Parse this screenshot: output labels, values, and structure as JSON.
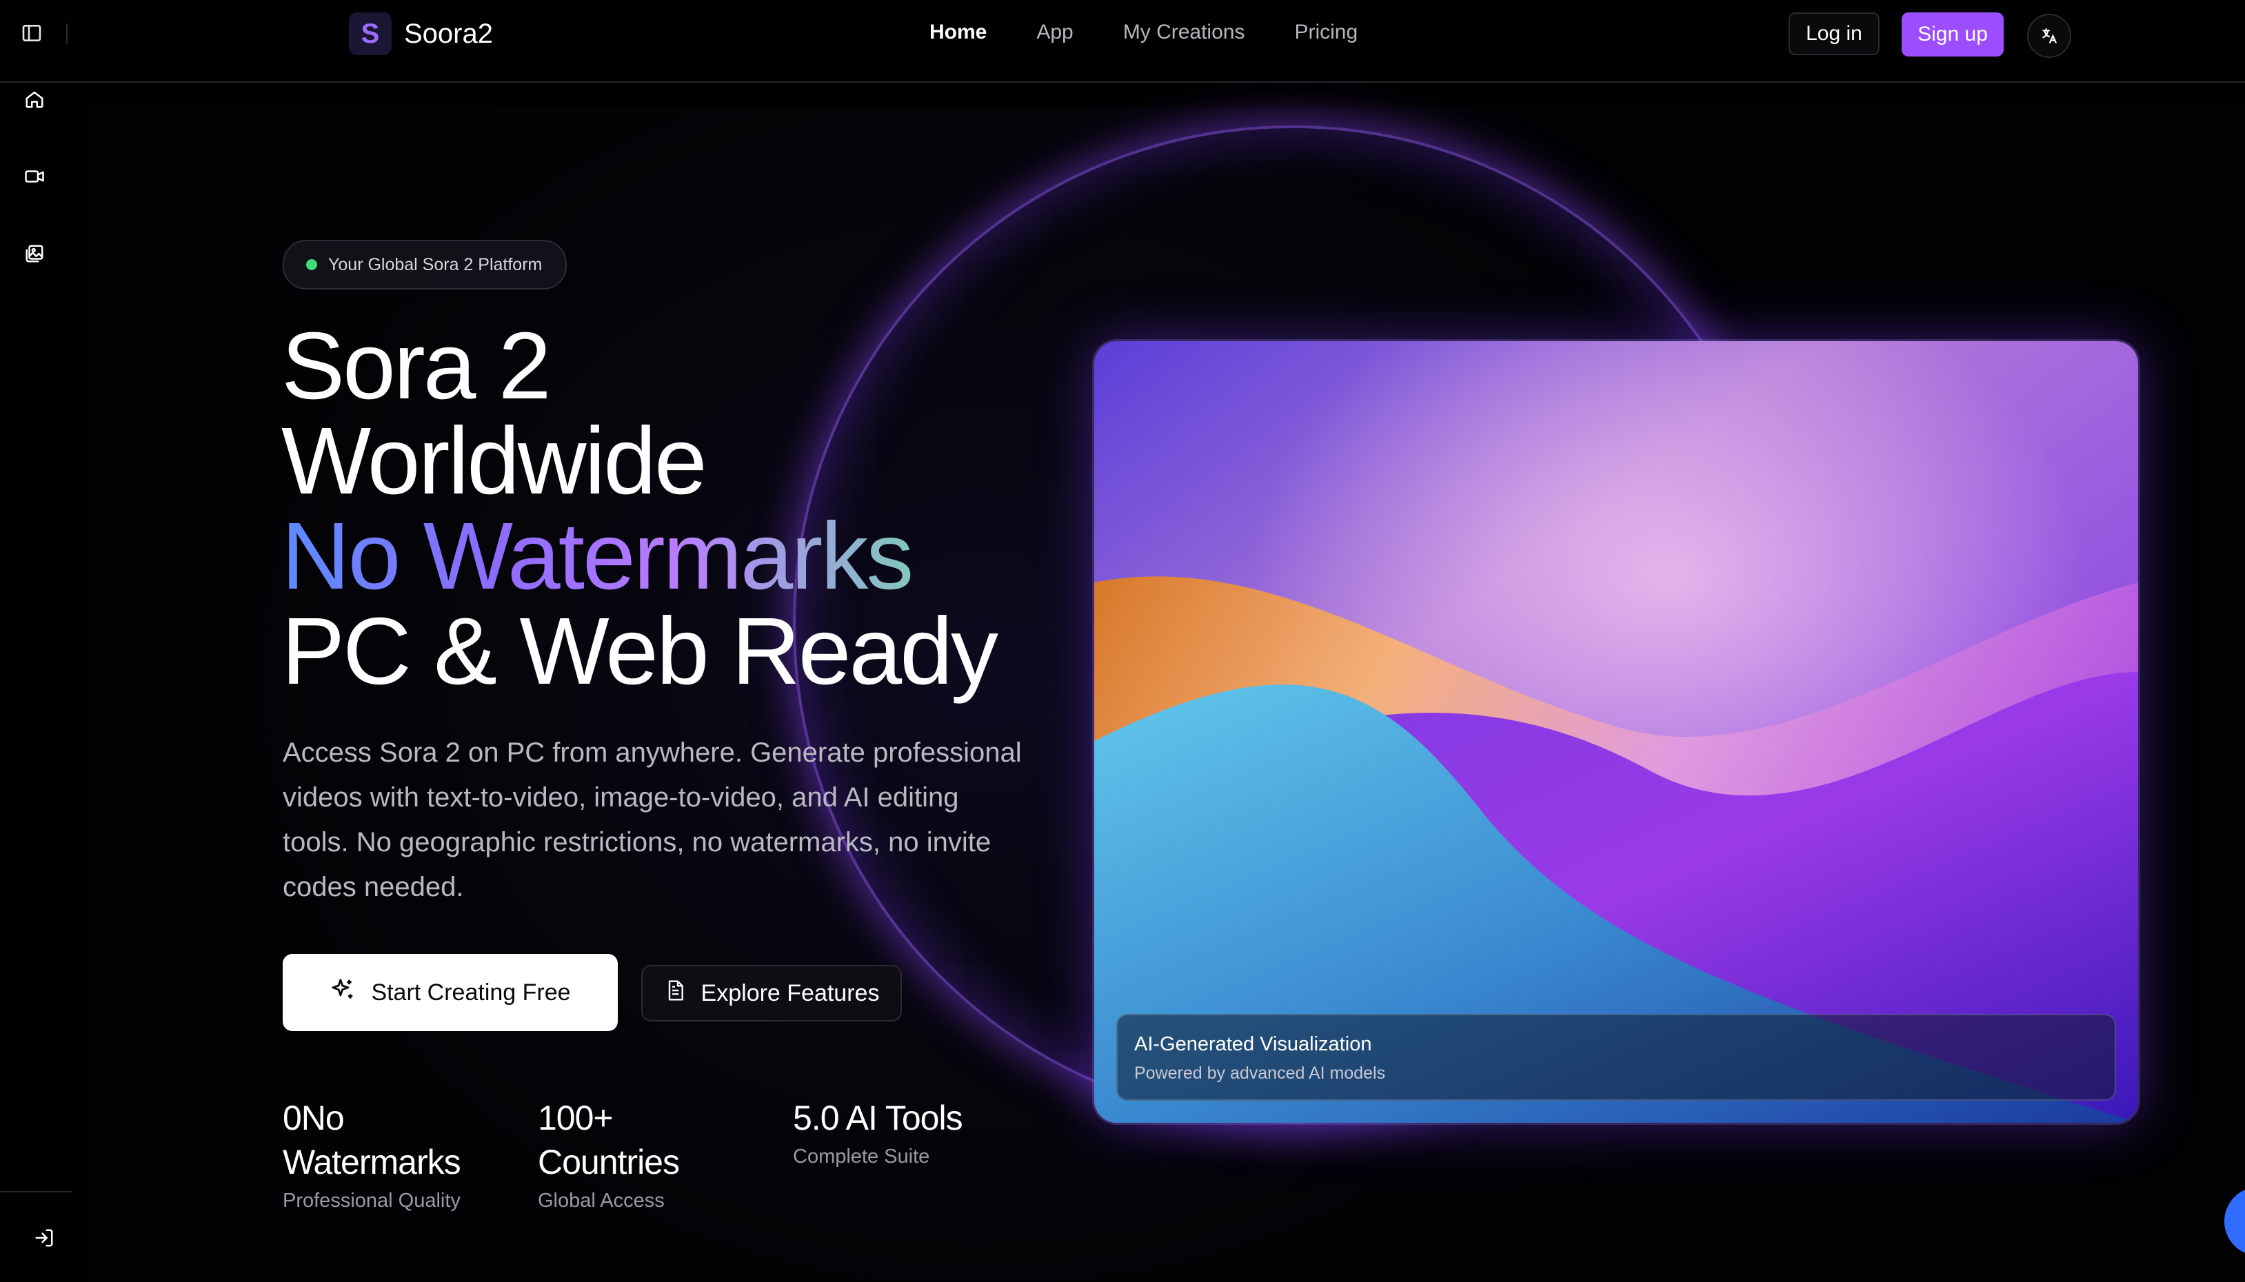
{
  "header": {
    "brand_initial": "S",
    "brand_name": "Soora2",
    "nav": [
      {
        "label": "Home",
        "active": true
      },
      {
        "label": "App",
        "active": false
      },
      {
        "label": "My Creations",
        "active": false
      },
      {
        "label": "Pricing",
        "active": false
      }
    ],
    "login_label": "Log in",
    "signup_label": "Sign up",
    "icons": {
      "sidebar_toggle": "sidebar-panel-icon",
      "language": "translate-icon"
    }
  },
  "sidebar": {
    "items": [
      "home-icon",
      "video-icon",
      "gallery-icon"
    ],
    "footer_icon": "sign-in-icon"
  },
  "hero": {
    "badge": "Your Global Sora 2 Platform",
    "headline": {
      "line1": "Sora 2",
      "line2": "Worldwide",
      "line3": "No Watermarks",
      "line4": "PC & Web Ready"
    },
    "description": "Access Sora 2 on PC from anywhere. Generate professional videos with text-to-video, image-to-video, and AI editing tools. No geographic restrictions, no watermarks, no invite codes needed.",
    "cta_primary": "Start Creating Free",
    "cta_secondary": "Explore Features",
    "stats": [
      {
        "value": "0No Watermarks",
        "label": "Professional Quality"
      },
      {
        "value": "100+ Countries",
        "label": "Global Access"
      },
      {
        "value": "5.0 AI Tools",
        "label": "Complete Suite"
      }
    ]
  },
  "visual": {
    "caption_title": "AI-Generated Visualization",
    "caption_subtitle": "Powered by advanced AI models"
  },
  "colors": {
    "accent": "#9b4dff",
    "badge_dot": "#3fdc7a",
    "gradient": [
      "#5b8cff",
      "#b97cff",
      "#6ee2a6"
    ],
    "chat_button": "#2f6cff"
  }
}
